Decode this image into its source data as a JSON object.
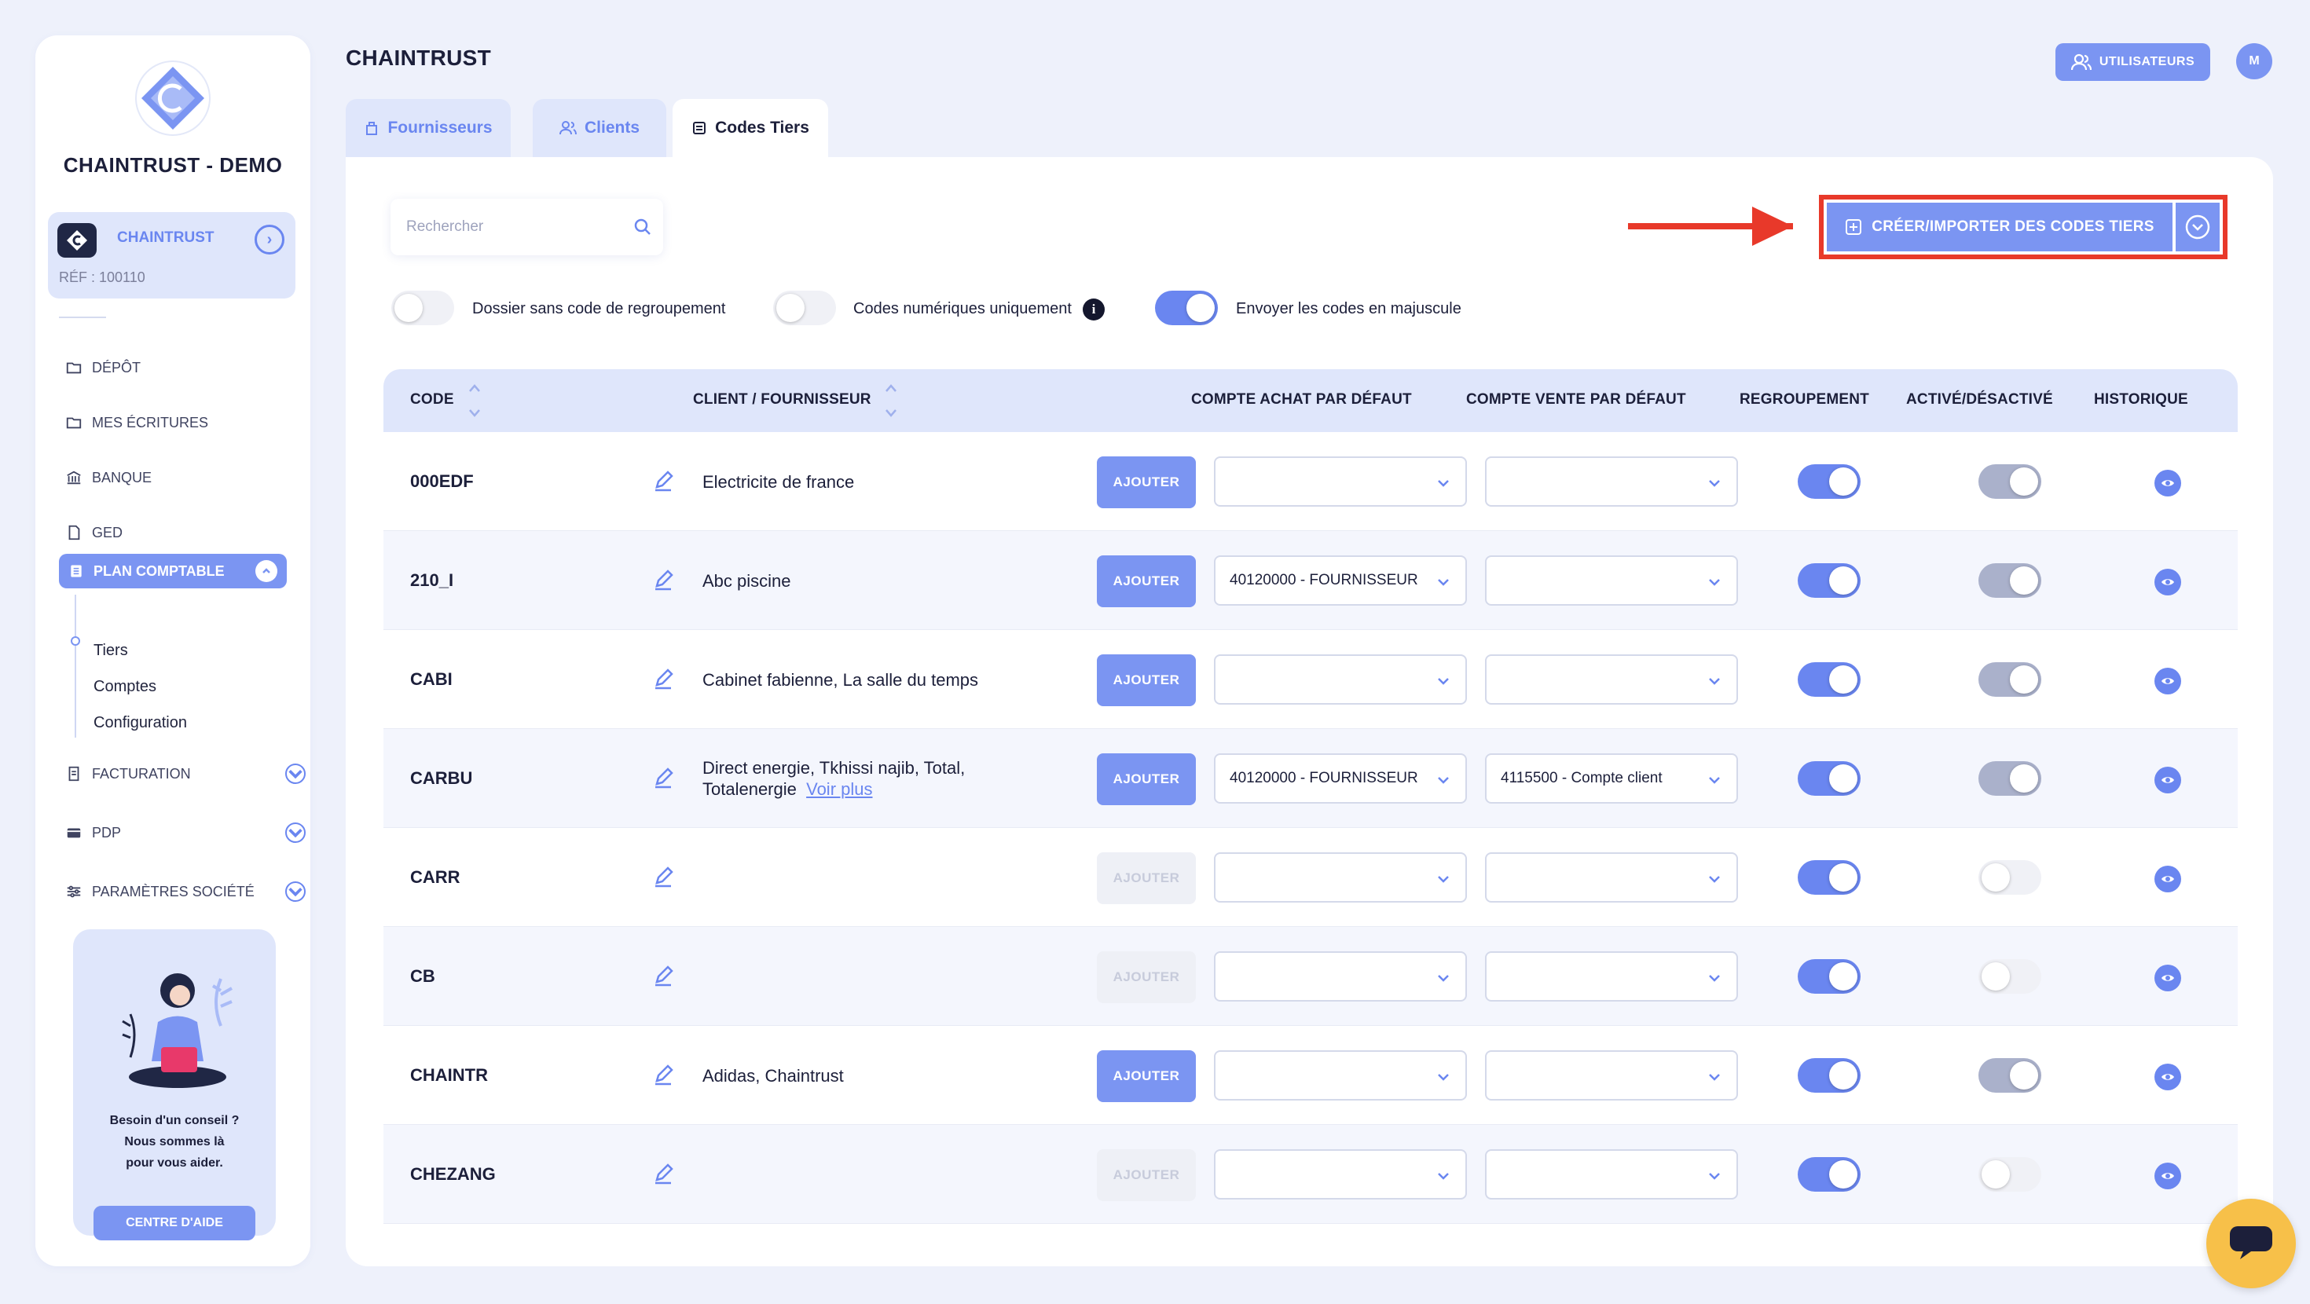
{
  "sidebar": {
    "company_name": "CHAINTRUST - DEMO",
    "card": {
      "name": "CHAINTRUST",
      "ref": "RÉF : 100110"
    },
    "nav": {
      "depot": "DÉPÔT",
      "ecritures": "MES ÉCRITURES",
      "banque": "BANQUE",
      "ged": "GED",
      "plan": "PLAN COMPTABLE",
      "sub": [
        "Tiers",
        "Comptes",
        "Configuration"
      ],
      "facturation": "FACTURATION",
      "pdp": "PDP",
      "parametres": "PARAMÈTRES SOCIÉTÉ"
    },
    "help": {
      "text": "Besoin d'un conseil ?\nNous sommes là\npour vous aider.",
      "button": "CENTRE D'AIDE"
    }
  },
  "header": {
    "title": "CHAINTRUST",
    "users_button": "UTILISATEURS",
    "avatar_initial": "M",
    "tabs": [
      "Fournisseurs",
      "Clients",
      "Codes Tiers"
    ],
    "active_tab": "Codes Tiers"
  },
  "toolbar": {
    "search_placeholder": "Rechercher",
    "create_button": "CRÉER/IMPORTER DES CODES TIERS",
    "options": [
      {
        "label": "Dossier sans code de regroupement",
        "on": false
      },
      {
        "label": "Codes numériques uniquement",
        "on": false
      },
      {
        "label": "Envoyer les codes en majuscule",
        "on": true
      }
    ],
    "info_glyph": "i"
  },
  "table": {
    "headers": {
      "code": "CODE",
      "client": "CLIENT / FOURNISSEUR",
      "achat": "COMPTE ACHAT PAR DÉFAUT",
      "vente": "COMPTE VENTE PAR DÉFAUT",
      "regroupement": "REGROUPEMENT",
      "active": "ACTIVÉ/DÉSACTIVÉ",
      "historique": "HISTORIQUE"
    },
    "add_label": "AJOUTER",
    "rows": [
      {
        "code": "000EDF",
        "client": "Electricite de france",
        "more": "",
        "add_enabled": true,
        "achat": "",
        "vente": "",
        "regroupement": true,
        "active": true
      },
      {
        "code": "210_I",
        "client": "Abc piscine",
        "more": "",
        "add_enabled": true,
        "achat": "40120000 - FOURNISSEUR",
        "vente": "",
        "regroupement": true,
        "active": true
      },
      {
        "code": "CABI",
        "client": "Cabinet fabienne, La salle du temps",
        "more": "",
        "add_enabled": true,
        "achat": "",
        "vente": "",
        "regroupement": true,
        "active": true
      },
      {
        "code": "CARBU",
        "client": "Direct energie, Tkhissi najib, Total,",
        "client2": "Totalenergie",
        "more": "Voir plus",
        "add_enabled": true,
        "achat": "40120000 - FOURNISSEUR",
        "vente": "4115500 - Compte client",
        "regroupement": true,
        "active": true
      },
      {
        "code": "CARR",
        "client": "",
        "more": "",
        "add_enabled": false,
        "achat": "",
        "vente": "",
        "regroupement": true,
        "active": false
      },
      {
        "code": "CB",
        "client": "",
        "more": "",
        "add_enabled": false,
        "achat": "",
        "vente": "",
        "regroupement": true,
        "active": false
      },
      {
        "code": "CHAINTR",
        "client": "Adidas, Chaintrust",
        "more": "",
        "add_enabled": true,
        "achat": "",
        "vente": "",
        "regroupement": true,
        "active": true
      },
      {
        "code": "CHEZANG",
        "client": "",
        "more": "",
        "add_enabled": false,
        "achat": "",
        "vente": "",
        "regroupement": true,
        "active": false
      }
    ]
  },
  "colors": {
    "accent": "#7b95f2",
    "accent_dark": "#6a86f0",
    "highlight": "#e8392a",
    "chat": "#f7c049"
  }
}
